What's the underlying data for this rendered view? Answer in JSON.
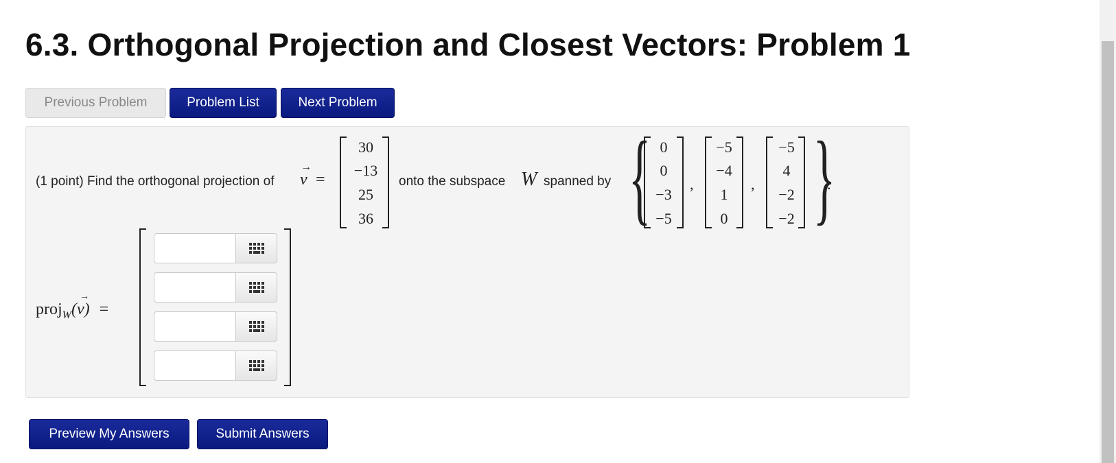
{
  "title": "6.3. Orthogonal Projection and Closest Vectors: Problem 1",
  "nav": {
    "previous": "Previous Problem",
    "list": "Problem List",
    "next": "Next Problem"
  },
  "problem": {
    "intro": "(1 point) Find the orthogonal projection of",
    "v_symbol": "v",
    "equals": "=",
    "vector_v": [
      "30",
      "−13",
      "25",
      "36"
    ],
    "onto_text": "onto the subspace",
    "subspace_symbol": "W",
    "spanned_text": "spanned by",
    "basis": [
      [
        "0",
        "0",
        "−3",
        "−5"
      ],
      [
        "−5",
        "−4",
        "1",
        "0"
      ],
      [
        "−5",
        "4",
        "−2",
        "−2"
      ]
    ],
    "comma": ",",
    "period": ".",
    "proj_label": "proj",
    "proj_sub": "W",
    "proj_arg": "(v)",
    "answers": [
      {
        "value": "",
        "placeholder": ""
      },
      {
        "value": "",
        "placeholder": ""
      },
      {
        "value": "",
        "placeholder": ""
      },
      {
        "value": "",
        "placeholder": ""
      }
    ],
    "keypad_icon": "keypad-icon"
  },
  "actions": {
    "preview": "Preview My Answers",
    "submit": "Submit Answers"
  }
}
